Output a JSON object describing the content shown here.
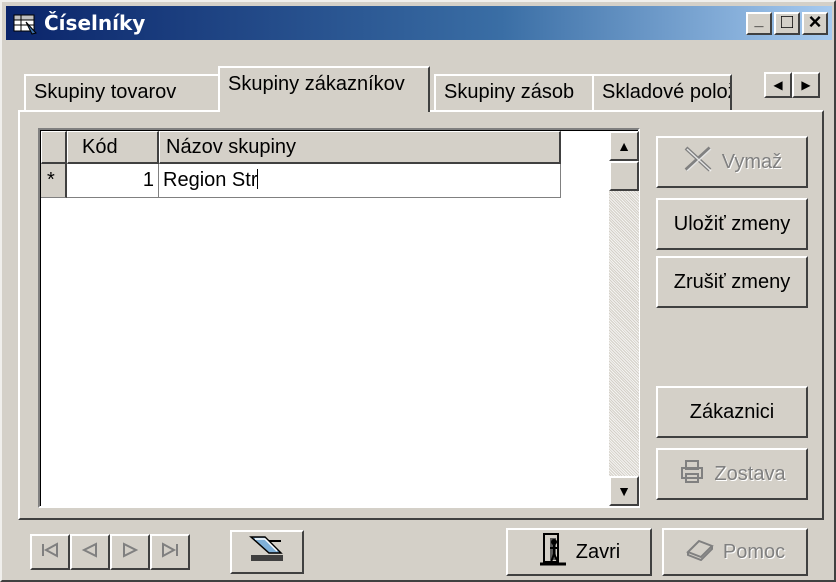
{
  "window": {
    "title": "Číselníky",
    "controls": {
      "minimize": "_",
      "maximize": "□",
      "close": "×"
    }
  },
  "tabs": [
    {
      "label": "Skupiny tovarov",
      "active": false
    },
    {
      "label": "Skupiny zákazníkov",
      "active": true
    },
    {
      "label": "Skupiny zásob",
      "active": false
    },
    {
      "label": "Skladové položky",
      "active": false
    }
  ],
  "tab_scroll": {
    "left": "◀",
    "right": "▶"
  },
  "grid": {
    "columns": [
      "Kód",
      "Názov skupiny"
    ],
    "rows": [
      {
        "indicator": "*",
        "kod": "1",
        "nazov": "Region Str"
      }
    ]
  },
  "scroll": {
    "up": "▲",
    "down": "▼"
  },
  "side_buttons": {
    "vymaz": "Vymaž",
    "ulozit": "Uložiť zmeny",
    "zrusit": "Zrušiť zmeny",
    "zakaznici": "Zákaznici",
    "zostava": "Zostava"
  },
  "bottom_buttons": {
    "zavri": "Zavri",
    "pomoc": "Pomoc"
  },
  "icons": {
    "app": "table-icon",
    "delete": "x-icon",
    "report": "printer-icon",
    "filter": "tool-icon",
    "close": "exit-door-icon",
    "help": "help-book-icon"
  }
}
